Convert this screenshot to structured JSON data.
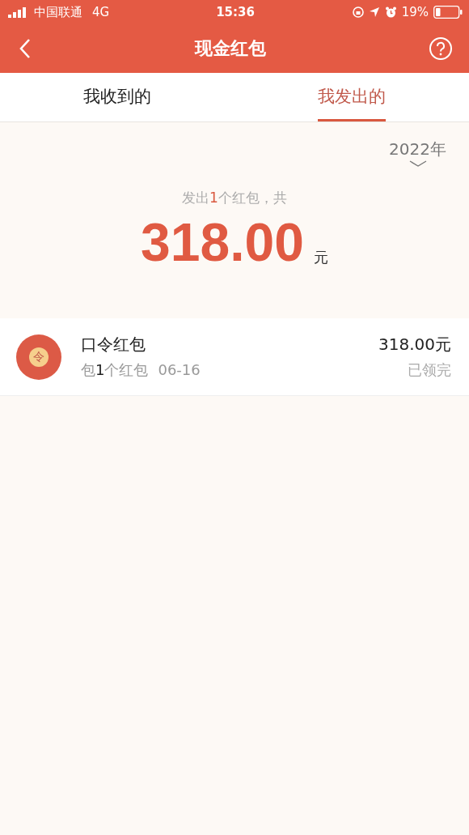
{
  "status_bar": {
    "carrier": "中国联通",
    "network": "4G",
    "time": "15:36",
    "battery": "19%"
  },
  "header": {
    "title": "现金红包"
  },
  "tabs": [
    {
      "label": "我收到的",
      "selected": false
    },
    {
      "label": "我发出的",
      "selected": true
    }
  ],
  "summary": {
    "year": "2022年",
    "prefix": "发出",
    "count": "1",
    "suffix": "个红包，共",
    "amount": "318.00",
    "unit": "元"
  },
  "packets": [
    {
      "icon_char": "令",
      "title": "口令红包",
      "detail_prefix": "包",
      "detail_count": "1",
      "detail_suffix": "个红包",
      "date": "06-16",
      "amount": "318.00元",
      "status": "已领完"
    }
  ]
}
